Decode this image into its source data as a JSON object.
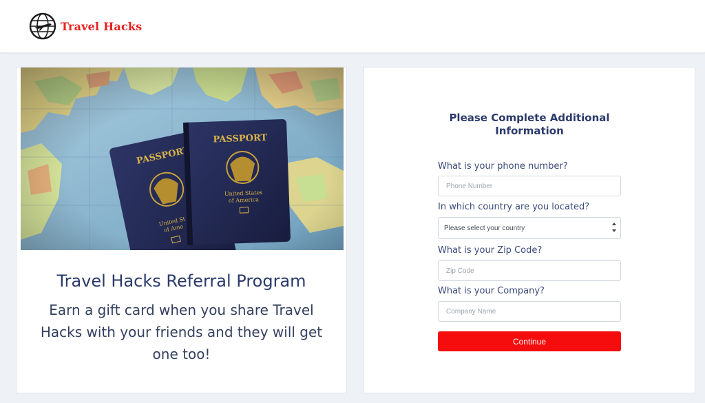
{
  "brand": {
    "name": "Travel Hacks",
    "accent": "#e8201f"
  },
  "promo": {
    "title": "Travel Hacks Referral Program",
    "body": "Earn a gift card when you share Travel Hacks with your friends and they will get one too!",
    "image": {
      "passport_label": "PASSPORT",
      "country_line1": "United States",
      "country_line2": "of America",
      "back_country_line1": "United St",
      "back_country_line2": "of Ame"
    }
  },
  "form": {
    "title": "Please Complete Additional Information",
    "phone": {
      "label": "What is your phone number?",
      "placeholder": "Phone Number"
    },
    "country": {
      "label": "In which country are you located?",
      "selected": "Please select your country"
    },
    "zip": {
      "label": "What is your Zip Code?",
      "placeholder": "Zip Code"
    },
    "company": {
      "label": "What is your Company?",
      "placeholder": "Company Name"
    },
    "submit_label": "Continue",
    "submit_color": "#f50c0c"
  }
}
